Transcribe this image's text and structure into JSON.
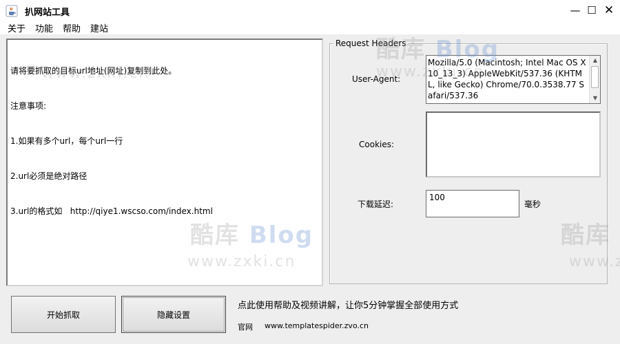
{
  "window": {
    "title": "扒网站工具",
    "minimize": "—",
    "maximize": "☐",
    "close": "✕"
  },
  "menu": [
    "关于",
    "功能",
    "帮助",
    "建站"
  ],
  "url_input": {
    "lines": [
      "请将要抓取的目标url地址(网址)复制到此处。",
      "注意事项:",
      "1.如果有多个url，每个url一行",
      "2.url必须是绝对路径",
      "3.url的格式如   http://qiye1.wscso.com/index.html"
    ]
  },
  "request_headers": {
    "legend": "Request Headers",
    "user_agent_label": "User-Agent:",
    "user_agent_value": "Mozilla/5.0 (Macintosh; Intel Mac OS X 10_13_3) AppleWebKit/537.36 (KHTML, like Gecko) Chrome/70.0.3538.77 Safari/537.36",
    "cookies_label": "Cookies:",
    "cookies_value": "",
    "delay_label": "下载延迟:",
    "delay_value": "100",
    "delay_unit": "毫秒"
  },
  "buttons": {
    "start": "开始抓取",
    "hide_settings": "隐藏设置"
  },
  "help": {
    "text": "点此使用帮助及视频讲解，让你5分钟掌握全部使用方式",
    "site_label": "官网",
    "site_url": "www.templatespider.zvo.cn"
  },
  "watermark": {
    "cn": "酷库",
    "en": "Blog",
    "url": "www.zxki.cn"
  },
  "icons": {
    "app": "java-cup-icon",
    "scroll_up": "▲",
    "scroll_down": "▼"
  }
}
